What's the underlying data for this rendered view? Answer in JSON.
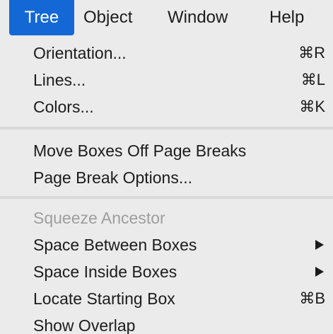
{
  "menubar": {
    "items": [
      {
        "label": "Tree",
        "active": true
      },
      {
        "label": "Object"
      },
      {
        "label": "Window"
      },
      {
        "label": "Help"
      }
    ]
  },
  "menu": {
    "groups": [
      [
        {
          "label": "Orientation...",
          "shortcut": "⌘R"
        },
        {
          "label": "Lines...",
          "shortcut": "⌘L"
        },
        {
          "label": "Colors...",
          "shortcut": "⌘K"
        }
      ],
      [
        {
          "label": "Move Boxes Off Page Breaks"
        },
        {
          "label": "Page Break Options..."
        }
      ],
      [
        {
          "label": "Squeeze Ancestor",
          "disabled": true
        },
        {
          "label": "Space Between Boxes",
          "submenu": true
        },
        {
          "label": "Space Inside Boxes",
          "submenu": true
        },
        {
          "label": "Locate Starting Box",
          "shortcut": "⌘B"
        },
        {
          "label": "Show Overlap"
        }
      ]
    ]
  },
  "colors": {
    "menu_background": "#ebebeb",
    "highlight": "#1468d6",
    "text": "#1c1c1c",
    "disabled_text": "#9e9e9e",
    "separator": "#d9d9d9"
  }
}
